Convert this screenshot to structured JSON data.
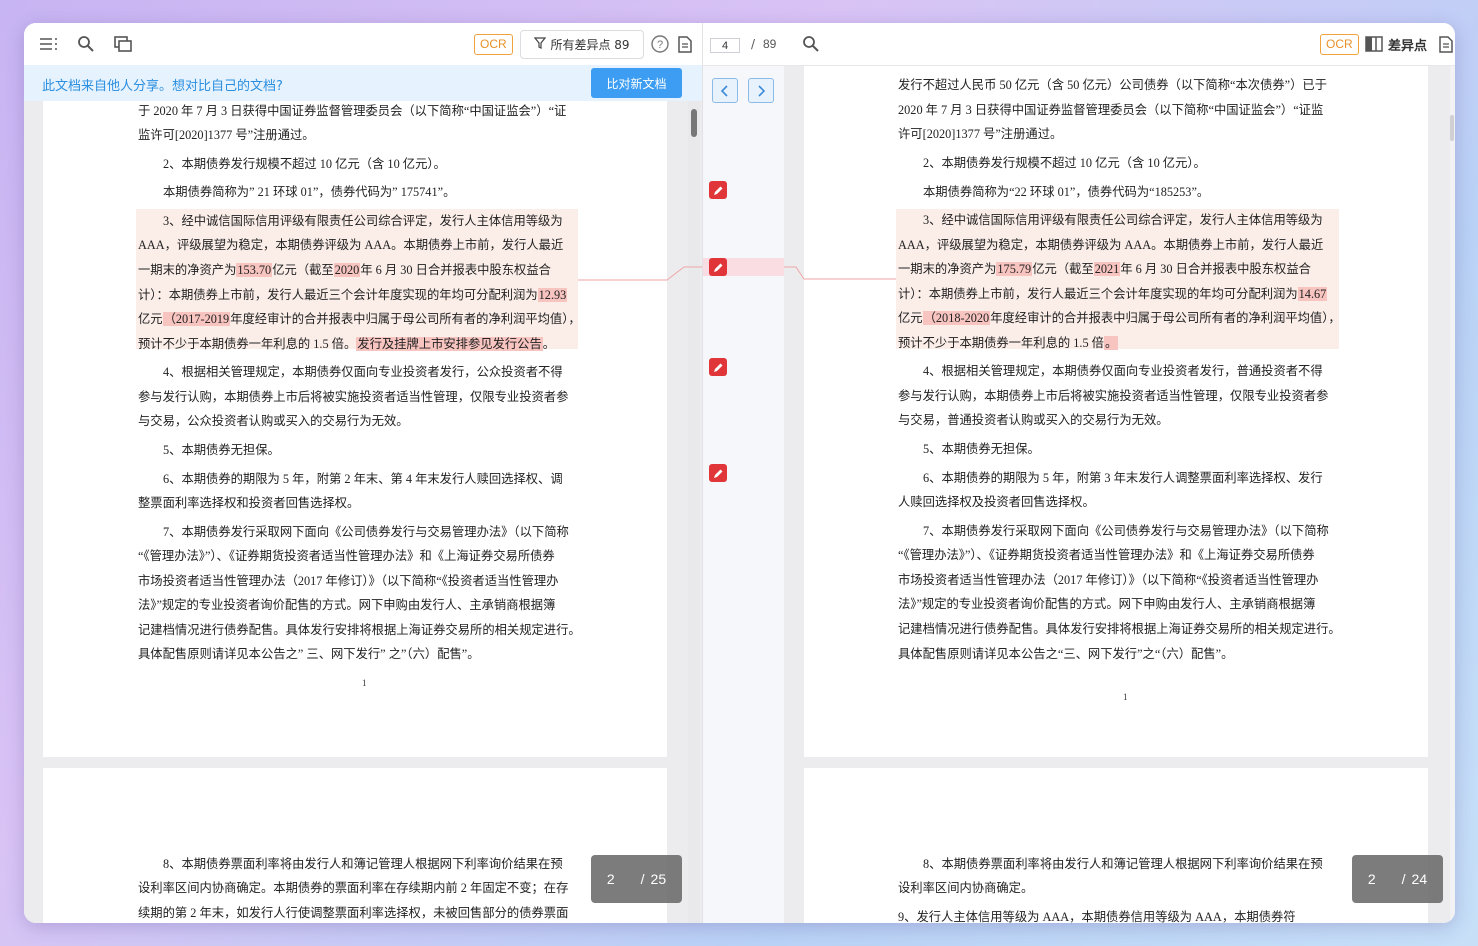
{
  "left_toolbar": {
    "ocr": "OCR",
    "filter_label": "所有差异点 89"
  },
  "share_bar": {
    "text": "此文档来自他人分享。想对比自己的文档?",
    "compare_button": "比对新文档"
  },
  "middle": {
    "current_page": "4",
    "separator": "/",
    "total": "89"
  },
  "right_toolbar": {
    "ocr": "OCR",
    "diff_label": "差异点"
  },
  "left_doc": {
    "page1_lines": [
      "于 2020 年 7 月 3 日获得中国证券监督管理委员会（以下简称“中国证监会”）“证",
      "监许可[2020]1377 号”注册通过。",
      "2、本期债券发行规模不超过 10 亿元（含 10 亿元）。",
      "本期债券简称为” 21 环球 01”，债券代码为” 175741”。"
    ],
    "item3": {
      "l1": "3、经中诚信国际信用评级有限责任公司综合评定，发行人主体信用等级为",
      "l2": "AAA，评级展望为稳定，本期债券评级为 AAA。本期债券上市前，发行人最近",
      "l3a": "一期末的净资产为",
      "l3_v1": "153.70",
      "l3b": "亿元（截至",
      "l3_v2": "2020",
      "l3c": "年 6 月 30 日合并报表中股东权益合",
      "l4a": "计）：本期债券上市前，发行人最近三个会计年度实现的年均可分配利润为",
      "l4_v": "12.93",
      "l5a": "亿元",
      "l5_v": "（2017-2019",
      "l5b": "年度经审计的合并报表中归属于母公司所有者的净利润平均值），",
      "l6a": "预计不少于本期债券一年利息的 1.5 倍。",
      "l6_v": "发行及挂牌上市安排参见发行公告",
      "l6b": "。"
    },
    "rest_lines": [
      "4、根据相关管理规定，本期债券仅面向专业投资者发行，公众投资者不得",
      "参与发行认购，本期债券上市后将被实施投资者适当性管理，仅限专业投资者参",
      "与交易，公众投资者认购或买入的交易行为无效。",
      "5、本期债券无担保。",
      "6、本期债券的期限为 5 年，附第 2 年末、第 4 年末发行人赎回选择权、调",
      "整票面利率选择权和投资者回售选择权。",
      "7、本期债券发行采取网下面向《公司债券发行与交易管理办法》（以下简称",
      "“《管理办法》”）、《证券期货投资者适当性管理办法》和《上海证券交易所债券",
      "市场投资者适当性管理办法（2017 年修订）》（以下简称“《投资者适当性管理办",
      "法》”规定的专业投资者询价配售的方式。网下申购由发行人、主承销商根据簿",
      "记建档情况进行债券配售。具体发行安排将根据上海证券交易所的相关规定进行。",
      "具体配售原则请详见本公告之” 三、网下发行” 之”（六）配售”。"
    ],
    "page_number": "1",
    "page2_lines": [
      "8、本期债券票面利率将由发行人和簿记管理人根据网下利率询价结果在预",
      "设利率区间内协商确定。本期债券的票面利率在存续期内前 2 年固定不变；在存",
      "续期的第 2 年末，如发行人行使调整票面利率选择权，未被回售部分的债券票面"
    ],
    "indicator_page": "2",
    "indicator_sep": "/",
    "indicator_total": "25"
  },
  "right_doc": {
    "page1_lines": [
      "发行不超过人民币 50 亿元（含 50 亿元）公司债券（以下简称“本次债券”）已于",
      "2020 年 7 月 3 日获得中国证券监督管理委员会（以下简称“中国证监会”）“证监",
      "许可[2020]1377 号”注册通过。",
      "2、本期债券发行规模不超过 10 亿元（含 10 亿元）。",
      "本期债券简称为“22 环球 01”，债券代码为“185253”。"
    ],
    "item3": {
      "l1": "3、经中诚信国际信用评级有限责任公司综合评定，发行人主体信用等级为",
      "l2": "AAA，评级展望为稳定，本期债券评级为 AAA。本期债券上市前，发行人最近",
      "l3a": "一期末的净资产为",
      "l3_v1": "175.79",
      "l3b": "亿元（截至",
      "l3_v2": "2021",
      "l3c": "年 6 月 30 日合并报表中股东权益合",
      "l4a": "计）：本期债券上市前，发行人最近三个会计年度实现的年均可分配利润为",
      "l4_v": "14.67",
      "l5a": "亿元",
      "l5_v": "（2018-2020",
      "l5b": "年度经审计的合并报表中归属于母公司所有者的净利润平均值），",
      "l6a": "预计不少于本期债券一年利息的 1.5 倍",
      "l6_v": "。"
    },
    "rest_lines": [
      "4、根据相关管理规定，本期债券仅面向专业投资者发行，普通投资者不得",
      "参与发行认购，本期债券上市后将被实施投资者适当性管理，仅限专业投资者参",
      "与交易，普通投资者认购或买入的交易行为无效。",
      "5、本期债券无担保。",
      "6、本期债券的期限为 5 年，附第 3 年末发行人调整票面利率选择权、发行",
      "人赎回选择权及投资者回售选择权。",
      "7、本期债券发行采取网下面向《公司债券发行与交易管理办法》（以下简称",
      "“《管理办法》”）、《证券期货投资者适当性管理办法》和《上海证券交易所债券",
      "市场投资者适当性管理办法（2017 年修订）》（以下简称“《投资者适当性管理办",
      "法》”规定的专业投资者询价配售的方式。网下申购由发行人、主承销商根据簿",
      "记建档情况进行债券配售。具体发行安排将根据上海证券交易所的相关规定进行。",
      "具体配售原则请详见本公告之“三、网下发行”之“（六）配售”。"
    ],
    "page_number": "1",
    "page2_lines": [
      "8、本期债券票面利率将由发行人和簿记管理人根据网下利率询价结果在预",
      "设利率区间内协商确定。",
      "9、发行人主体信用等级为 AAA，本期债券信用等级为 AAA，本期债券符"
    ],
    "indicator_page": "2",
    "indicator_sep": "/",
    "indicator_total": "24"
  },
  "colors": {
    "accent_blue": "#3d9df2",
    "diff_highlight": "#f7c4c0",
    "diff_block": "#fbeee9",
    "marker_red": "#e0363a",
    "ocr_orange": "#e8902a"
  }
}
